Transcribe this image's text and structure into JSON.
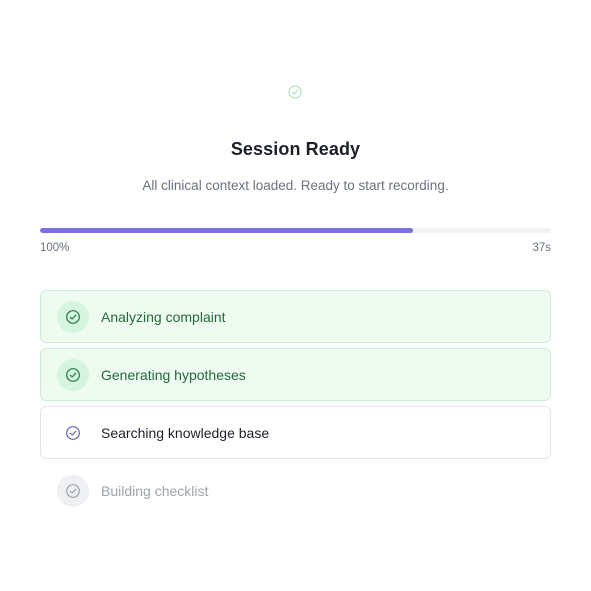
{
  "header": {
    "icon": "check-circle-icon",
    "title": "Session Ready",
    "subtitle": "All clinical context loaded. Ready to start recording."
  },
  "progress": {
    "percent_label": "100%",
    "time_label": "37s",
    "fill_fraction": 0.73
  },
  "steps": [
    {
      "label": "Analyzing complaint",
      "status": "done",
      "icon": "check-circle-icon"
    },
    {
      "label": "Generating hypotheses",
      "status": "done",
      "icon": "check-circle-icon"
    },
    {
      "label": "Searching knowledge base",
      "status": "active",
      "icon": "check-circle-icon"
    },
    {
      "label": "Building checklist",
      "status": "pending",
      "icon": "check-circle-icon"
    }
  ],
  "colors": {
    "accent": "#7c6fe0",
    "done_bg": "#effbf1",
    "done_text": "#1f6b3a",
    "active_icon": "#6366b8",
    "pending_text": "#9ca3af"
  }
}
